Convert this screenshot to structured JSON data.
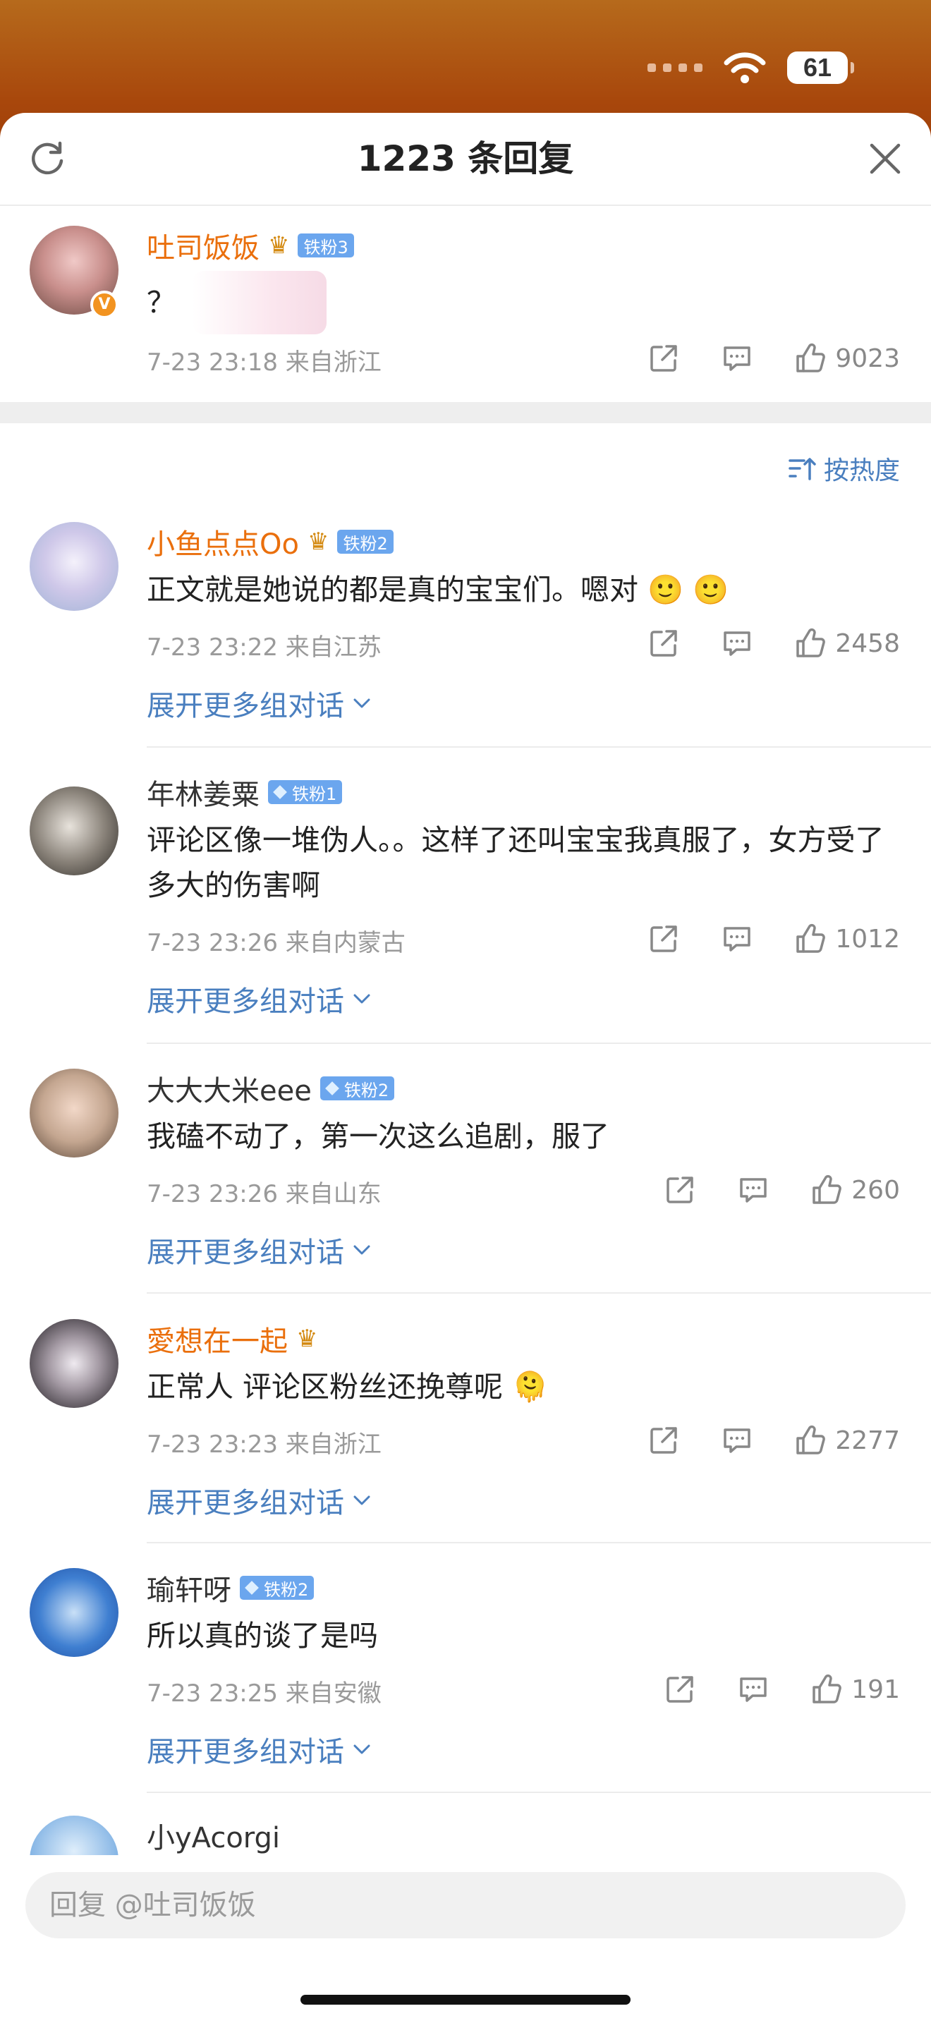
{
  "status_bar": {
    "battery": "61"
  },
  "header": {
    "title": "1223 条回复"
  },
  "root_comment": {
    "name": "吐司饭饭",
    "badge": "铁粉3",
    "text": "？",
    "time": "7-23 23:18  来自浙江",
    "likes": "9023"
  },
  "sort": {
    "label": "按热度"
  },
  "replies": [
    {
      "name": "小鱼点点Oo",
      "badge": "铁粉2",
      "vip": true,
      "text": "正文就是她说的都是真的宝宝们。嗯对 🙂 🙂",
      "time": "7-23 23:22  来自江苏",
      "likes": "2458",
      "expand": "展开更多组对话"
    },
    {
      "name": "年林姜粟",
      "badge": "铁粉1",
      "vip": false,
      "text": "评论区像一堆伪人。。这样了还叫宝宝我真服了，女方受了多大的伤害啊",
      "time": "7-23 23:26  来自内蒙古",
      "likes": "1012",
      "expand": "展开更多组对话"
    },
    {
      "name": "大大大米eee",
      "badge": "铁粉2",
      "vip": false,
      "text": "我磕不动了，第一次这么追剧，服了",
      "time": "7-23 23:26  来自山东",
      "likes": "260",
      "expand": "展开更多组对话"
    },
    {
      "name": "愛想在一起",
      "badge": "",
      "vip": true,
      "text": "正常人 评论区粉丝还挽尊呢 🫠",
      "time": "7-23 23:23  来自浙江",
      "likes": "2277",
      "expand": "展开更多组对话"
    },
    {
      "name": "瑜轩呀",
      "badge": "铁粉2",
      "vip": false,
      "text": "所以真的谈了是吗",
      "time": "7-23 23:25  来自安徽",
      "likes": "191",
      "expand": "展开更多组对话"
    },
    {
      "name": "小yAcorgi"
    }
  ],
  "reply_box": {
    "placeholder": "回复 @吐司饭饭"
  },
  "colors": {
    "accent_blue": "#4a7fbf",
    "vip_orange": "#ea6f0c",
    "badge_blue": "#6ba6ee"
  },
  "icons": [
    "refresh-icon",
    "close-icon",
    "share-icon",
    "comment-icon",
    "like-icon",
    "sort-icon",
    "chevron-down-icon",
    "wifi-icon",
    "crown-icon"
  ]
}
